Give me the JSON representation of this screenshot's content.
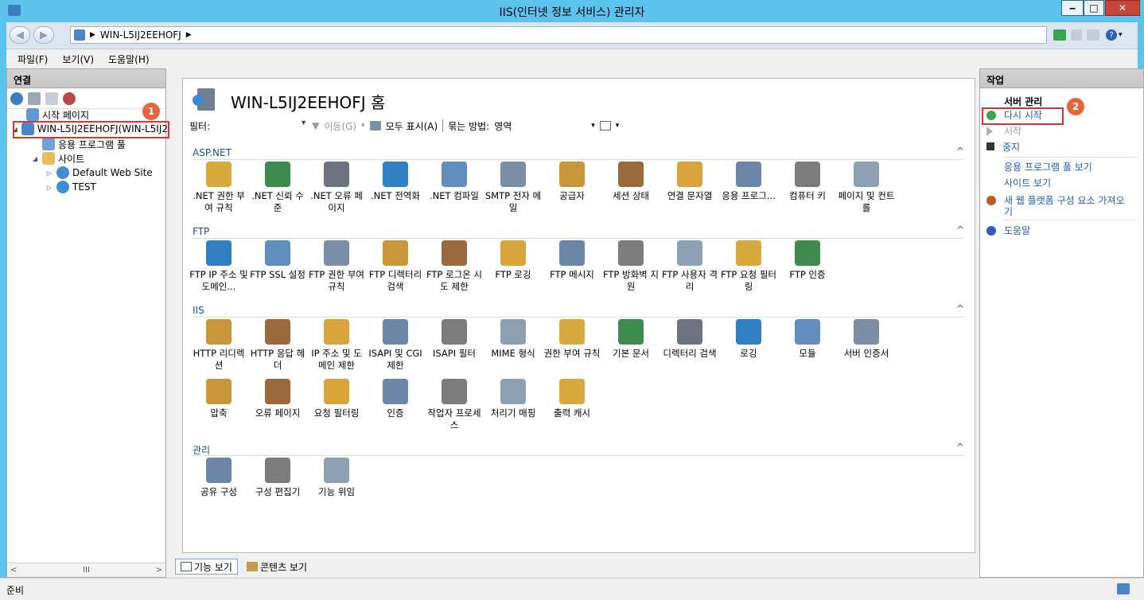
{
  "window": {
    "title": "IIS(인터넷 정보 서비스) 관리자",
    "minimize": "‒",
    "maximize": "□",
    "close": "✕"
  },
  "address": {
    "crumbs": [
      "WIN-L5IJ2EEHOFJ"
    ]
  },
  "menu": [
    "파일(F)",
    "보기(V)",
    "도움말(H)"
  ],
  "connections": {
    "title": "연결",
    "tree": [
      {
        "label": "시작 페이지",
        "level": 1
      },
      {
        "label": "WIN-L5IJ2EEHOFJ(WIN-L5IJ2",
        "level": 1,
        "selected": true
      },
      {
        "label": "응용 프로그램 풀",
        "level": 2
      },
      {
        "label": "사이트",
        "level": 2
      },
      {
        "label": "Default Web Site",
        "level": 3
      },
      {
        "label": "TEST",
        "level": 3
      }
    ]
  },
  "home": {
    "title": "WIN-L5IJ2EEHOFJ 홈",
    "filter_label": "필터:",
    "go_label": "이동(G)",
    "show_all": "모두 표시(A)",
    "group_label": "묶는 방법:",
    "group_value": "영역"
  },
  "sections": [
    {
      "title": "ASP.NET",
      "items": [
        ".NET 권한 부여 규칙",
        ".NET 신뢰 수준",
        ".NET 오류 페이지",
        ".NET 전역화",
        ".NET 컴파일",
        "SMTP 전자 메일",
        "공급자",
        "세션 상태",
        "연결 문자열",
        "응용 프로그...",
        "컴퓨터 키",
        "페이지 및 컨트롤"
      ]
    },
    {
      "title": "FTP",
      "items": [
        "FTP IP 주소 및 도메인...",
        "FTP SSL 설정",
        "FTP 권한 부여 규칙",
        "FTP 디렉터리 검색",
        "FTP 로그온 시도 제한",
        "FTP 로깅",
        "FTP 메시지",
        "FTP 방화벽 지원",
        "FTP 사용자 격리",
        "FTP 요청 필터링",
        "FTP 인증"
      ]
    },
    {
      "title": "IIS",
      "items": [
        "HTTP 리디렉션",
        "HTTP 응답 헤더",
        "IP 주소 및 도메인 제한",
        "ISAPI 및 CGI 제한",
        "ISAPI 필터",
        "MIME 형식",
        "권한 부여 규칙",
        "기본 문서",
        "디렉터리 검색",
        "로깅",
        "모듈",
        "서버 인증서",
        "압축",
        "오류 페이지",
        "요청 필터링",
        "인증",
        "작업자 프로세스",
        "처리기 매핑",
        "출력 캐시"
      ]
    },
    {
      "title": "관리",
      "items": [
        "공유 구성",
        "구성 편집기",
        "기능 위임"
      ]
    }
  ],
  "views": {
    "features": "기능 보기",
    "content": "콘텐츠 보기"
  },
  "actions": {
    "title": "작업",
    "group": "서버 관리",
    "restart": "다시 시작",
    "start": "시작",
    "stop": "중지",
    "app_pools": "응용 프로그램 풀 보기",
    "sites": "사이트 보기",
    "new_components": "새 웹 플랫폼 구성 요소 가져오기",
    "help": "도움말"
  },
  "markers": {
    "m1": "1",
    "m2": "2"
  },
  "status": "준비",
  "scroll": {
    "left": "<",
    "thumb": "III",
    "right": ">"
  }
}
